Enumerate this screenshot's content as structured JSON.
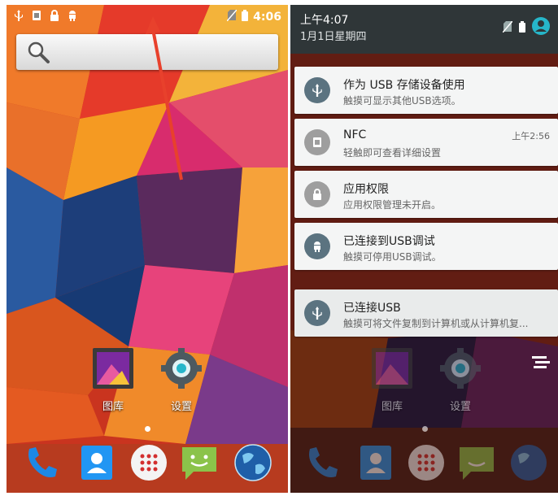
{
  "left_screen": {
    "status_time": "4:06",
    "apps": [
      {
        "label": "图库",
        "icon": "gallery-icon"
      },
      {
        "label": "设置",
        "icon": "settings-gear-icon"
      }
    ],
    "dock": [
      {
        "icon": "phone-icon"
      },
      {
        "icon": "contacts-icon"
      },
      {
        "icon": "app-drawer-icon"
      },
      {
        "icon": "messaging-icon"
      },
      {
        "icon": "browser-globe-icon"
      }
    ]
  },
  "right_screen": {
    "shade_time": "上午4:07",
    "shade_date": "1月1日星期四",
    "notifications": [
      {
        "title": "作为 USB 存储设备使用",
        "text": "触摸可显示其他USB选项。",
        "time": "",
        "icon": "usb-icon",
        "icon_color": "#5b7380"
      },
      {
        "title": "NFC",
        "text": "轻触即可查看详细设置",
        "time": "上午2:56",
        "icon": "nfc-icon",
        "icon_color": "#9e9e9e"
      },
      {
        "title": "应用权限",
        "text": "应用权限管理未开启。",
        "time": "",
        "icon": "lock-icon",
        "icon_color": "#9e9e9e"
      },
      {
        "title": "已连接到USB调试",
        "text": "触摸可停用USB调试。",
        "time": "",
        "icon": "android-icon",
        "icon_color": "#5b7380"
      },
      {
        "title": "已连接USB",
        "text": "触摸可将文件复制到计算机或从计算机复...",
        "time": "",
        "icon": "usb-icon",
        "icon_color": "#5b7380"
      }
    ],
    "apps": [
      {
        "label": "图库"
      },
      {
        "label": "设置"
      }
    ]
  },
  "colors": {
    "accent_teal": "#26b6c9",
    "shade_bg": "#2f3638",
    "arrow_red": "#e8412c"
  }
}
